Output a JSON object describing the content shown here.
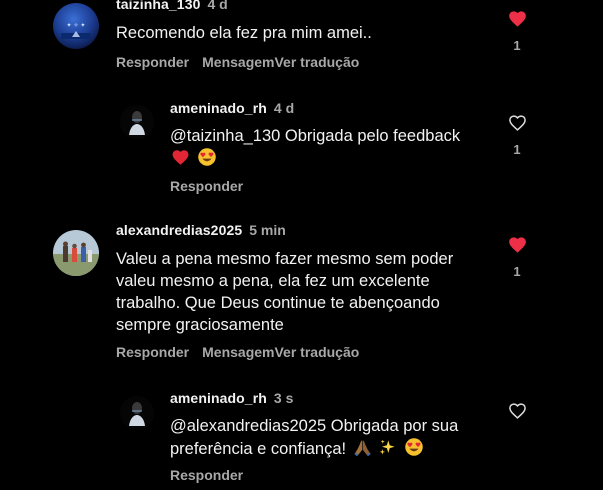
{
  "colors": {
    "background": "#000000",
    "text": "#f2f2f2",
    "muted": "#a8a8a8",
    "liked": "#ed2f47"
  },
  "comments": [
    {
      "username": "taizinha_130",
      "time": "4 d",
      "text": "Recomendo ela fez pra mim amei..",
      "liked": true,
      "like_count": "1",
      "actions": [
        "Responder",
        "Mensagem",
        "Ver tradução"
      ]
    },
    {
      "username": "ameninado_rh",
      "time": "4 d",
      "text": "@taizinha_130 Obrigada pelo feedback",
      "emojis": [
        "red-heart-emoji",
        "heart-eyes-emoji"
      ],
      "liked": false,
      "like_count": "1",
      "actions": [
        "Responder"
      ]
    },
    {
      "username": "alexandredias2025",
      "time": "5 min",
      "text_lines": [
        "Valeu a pena mesmo fazer mesmo sem poder",
        "valeu mesmo a pena,  ela fez um excelente",
        "trabalho.  Que Deus continue te abençoando",
        "sempre graciosamente"
      ],
      "liked": true,
      "like_count": "1",
      "actions": [
        "Responder",
        "Mensagem",
        "Ver tradução"
      ]
    },
    {
      "username": "ameninado_rh",
      "time": "3 s",
      "text_lines": [
        "@alexandredias2025 Obrigada por sua",
        "preferência e confiança!"
      ],
      "emojis": [
        "folded-hands-emoji",
        "sparkles-emoji",
        "heart-eyes-emoji"
      ],
      "liked": false,
      "actions": [
        "Responder"
      ]
    }
  ]
}
